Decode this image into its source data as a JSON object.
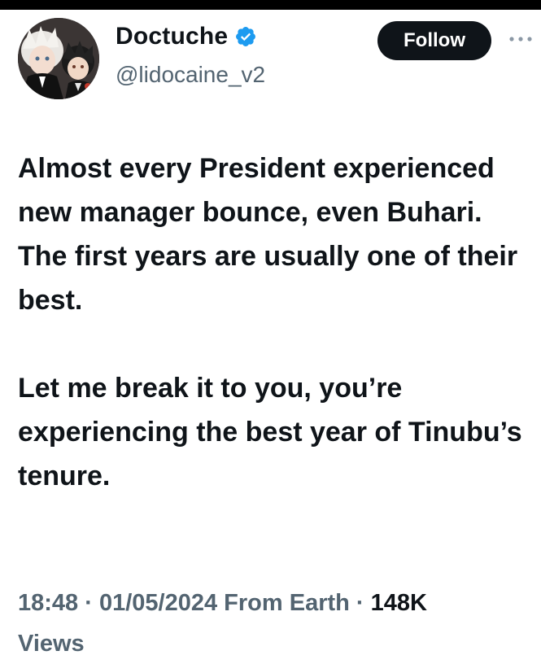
{
  "author": {
    "display_name": "Doctuche",
    "handle": "@lidocaine_v2",
    "verified": true,
    "avatar_icon": "anime-characters-avatar"
  },
  "actions": {
    "follow_label": "Follow",
    "more_icon": "more-horizontal-icon"
  },
  "tweet": {
    "paragraphs": [
      "Almost every President experienced new manager bounce, even Buhari. The first years are usually one of their best.",
      "Let me break it to you, you’re experiencing the best year of Tinubu’s tenure."
    ]
  },
  "meta": {
    "time": "18:48",
    "date": "01/05/2024",
    "source": "From Earth",
    "views_count": "148K",
    "views_label": "Views"
  },
  "colors": {
    "text_primary": "#0f1419",
    "text_secondary": "#536471",
    "verified_blue": "#1d9bf0",
    "button_bg": "#0f1419"
  }
}
